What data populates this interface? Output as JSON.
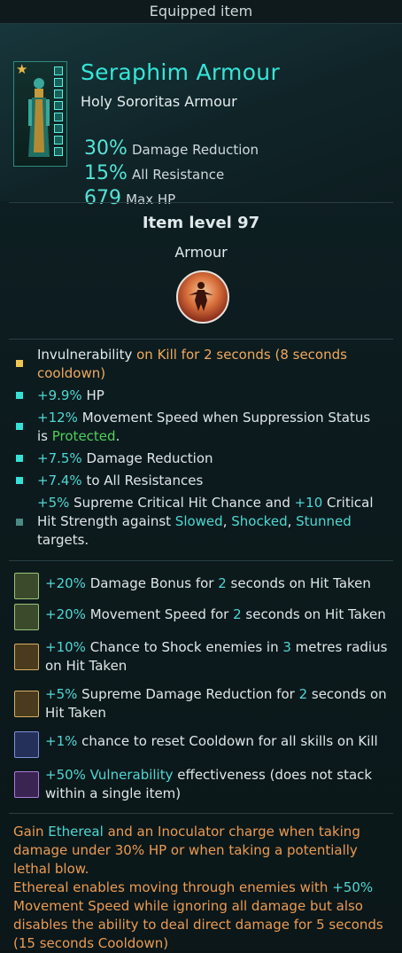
{
  "window": {
    "title": "Equipped item"
  },
  "item": {
    "name": "Seraphim Armour",
    "subtitle": "Holy Sororitas Armour",
    "stats": [
      {
        "value": "30%",
        "label": "Damage Reduction"
      },
      {
        "value": "15%",
        "label": "All Resistance"
      },
      {
        "value": "679",
        "label": "Max HP"
      }
    ],
    "level_text": "Item level 97",
    "type": "Armour"
  },
  "affixes": [
    {
      "parts": [
        "Invulnerability",
        " on Kill for 2 seconds (8 seconds",
        "cooldown)"
      ]
    },
    {
      "parts": [
        "+9.9%",
        " HP"
      ]
    },
    {
      "parts": [
        "+12%",
        " Movement Speed when Suppression Status",
        "is ",
        "Protected",
        "."
      ]
    },
    {
      "parts": [
        "+7.5%",
        " Damage Reduction"
      ]
    },
    {
      "parts": [
        "+7.4%",
        " to All Resistances"
      ]
    },
    {
      "parts": [
        "+5%",
        " Supreme Critical Hit Chance and ",
        "+10",
        " Critical",
        "Hit Strength against ",
        "Slowed",
        ", ",
        "Shocked",
        ", ",
        "Stunned",
        "targets."
      ]
    }
  ],
  "blessings": [
    {
      "parts": [
        "+20%",
        " Damage Bonus for ",
        "2",
        " seconds on Hit Taken"
      ],
      "tier": "green"
    },
    {
      "parts": [
        "+20%",
        " Movement Speed for ",
        "2",
        " seconds on Hit Taken"
      ],
      "tier": "green"
    },
    {
      "parts": [
        "+10%",
        " Chance to ",
        "Shock",
        " enemies in ",
        "3",
        " metres radius",
        "on Hit Taken"
      ],
      "tier": "gold"
    },
    {
      "parts": [
        "+5%",
        " Supreme Damage Reduction for ",
        "2",
        " seconds on",
        "Hit Taken"
      ],
      "tier": "gold"
    },
    {
      "parts": [
        "+1%",
        " chance to reset Cooldown for all skills on Kill"
      ],
      "tier": "blue"
    },
    {
      "parts": [
        "+50% Vulnerability",
        " effectiveness (does not stack",
        "within a single item)"
      ],
      "tier": "purple"
    }
  ],
  "footer": {
    "lines": [
      [
        "Gain ",
        "Ethereal",
        " and an Inoculator charge when taking"
      ],
      [
        "damage under 30% HP or when taking a potentially"
      ],
      [
        "lethal blow."
      ],
      [
        "Ethereal enables moving through enemies with ",
        "+50%"
      ],
      [
        "Movement Speed while ignoring all damage but also"
      ],
      [
        "disables the ability to deal direct damage for 5 seconds"
      ],
      [
        "(15 seconds Cooldown)"
      ]
    ]
  },
  "colors": {
    "accent": "#34e6d8",
    "highlight": "#4fd7d3",
    "legendary": "#f0a95e",
    "positive": "#4fcf5c"
  }
}
